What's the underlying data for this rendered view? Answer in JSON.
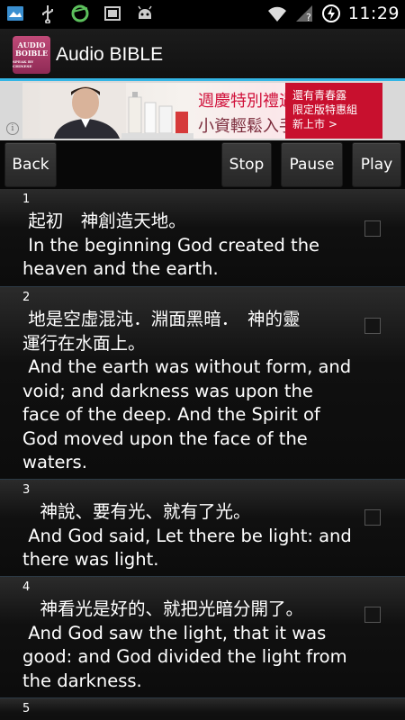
{
  "status_bar": {
    "time": "11:29"
  },
  "app": {
    "title": "Audio BIBLE",
    "icon_line1": "AUDIO",
    "icon_line2": "BOIBLE",
    "icon_line3": "SPEAK BY CHINESE"
  },
  "ad": {
    "line1": "週慶特別禮遇",
    "line2": "小資輕鬆入手",
    "side_line1": "還有青春露",
    "side_line2": "限定版特惠組",
    "side_line3": "新上市 >",
    "info": "i"
  },
  "controls": {
    "back": "Back",
    "stop": "Stop",
    "pause": "Pause",
    "play": "Play"
  },
  "verses": [
    {
      "num": "1",
      "text": " 起初　神創造天地。\n In the beginning God created the\nheaven and the earth."
    },
    {
      "num": "2",
      "text": " 地是空虛混沌．淵面黑暗．　神的靈\n運行在水面上。\n And the earth was without form, and\nvoid; and darkness was upon the\nface of the deep. And the Spirit of\nGod moved upon the face of the\nwaters."
    },
    {
      "num": "3",
      "text": "　神說、要有光、就有了光。\n And God said, Let there be light: and\nthere was light."
    },
    {
      "num": "4",
      "text": "　神看光是好的、就把光暗分開了。\n And God saw the light, that it was\ngood: and God divided the light from\nthe darkness."
    },
    {
      "num": "5",
      "text": ""
    }
  ]
}
